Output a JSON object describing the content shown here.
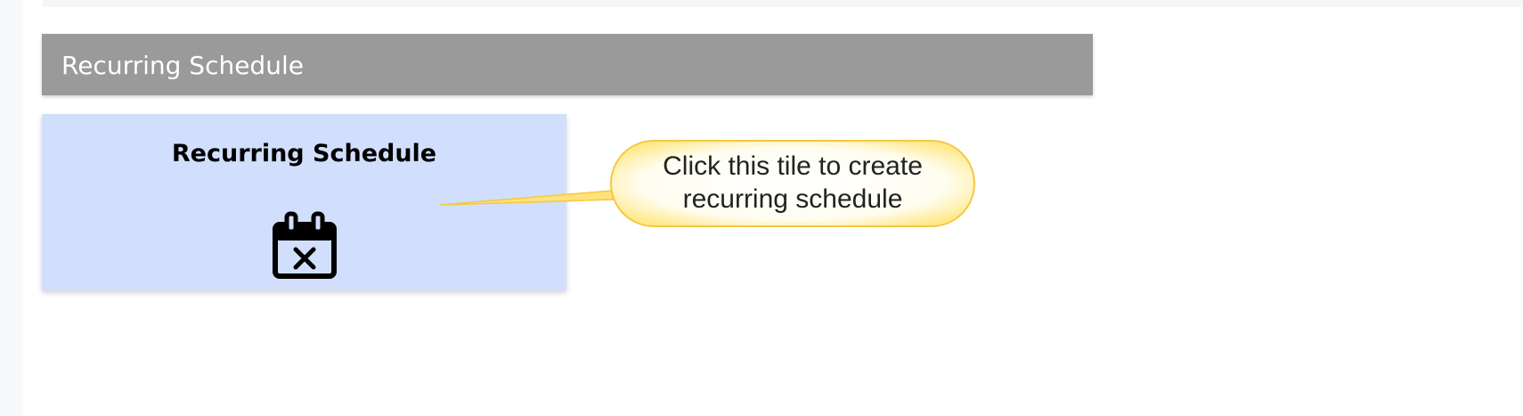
{
  "section": {
    "title": "Recurring Schedule"
  },
  "tile": {
    "title": "Recurring Schedule",
    "icon": "calendar-x-icon"
  },
  "callout": {
    "line1": "Click this tile to create",
    "line2": "recurring schedule"
  },
  "colors": {
    "header_bg": "#9a9a9a",
    "tile_bg": "#d1dffc",
    "callout_fill": "#fffef4",
    "callout_border": "#f5c842"
  }
}
